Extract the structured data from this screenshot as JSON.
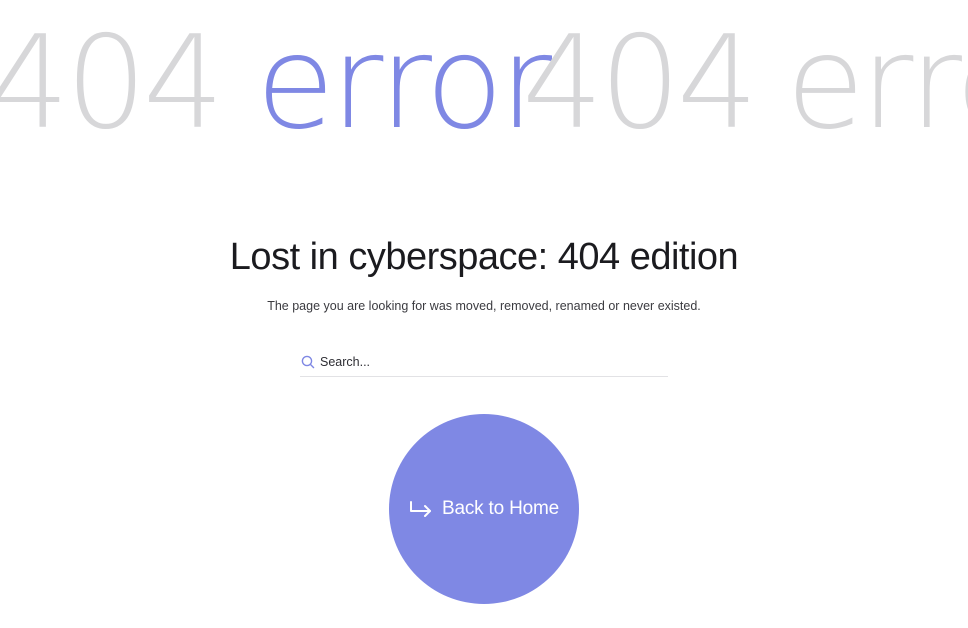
{
  "marquee": {
    "words": [
      "404",
      "error",
      "404",
      "erro"
    ]
  },
  "content": {
    "title": "Lost in cyberspace: 404 edition",
    "subtitle": "The page you are looking for was moved, removed, renamed or never existed."
  },
  "search": {
    "placeholder": "Search...",
    "value": "",
    "icon": "search-icon"
  },
  "home_button": {
    "label": "Back to Home",
    "icon": "return-arrow-icon"
  },
  "colors": {
    "accent": "#7f88e4",
    "marquee_muted": "#d7d7d9",
    "text": "#1b1b1f",
    "background": "#ffffff"
  }
}
